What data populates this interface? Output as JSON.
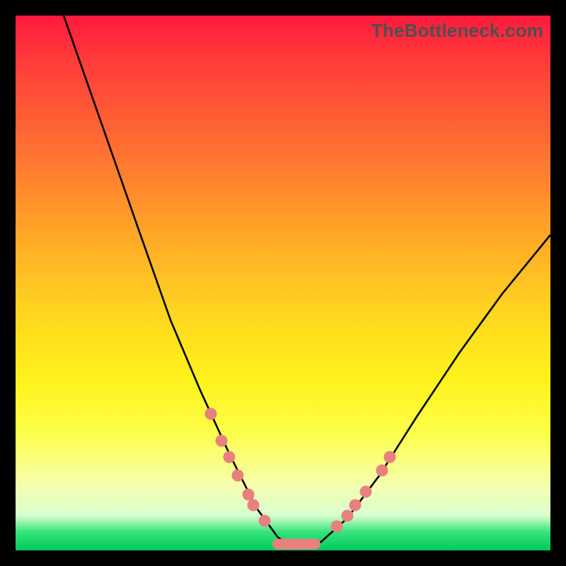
{
  "watermark": "TheBottleneck.com",
  "chart_data": {
    "type": "line",
    "title": "",
    "xlabel": "",
    "ylabel": "",
    "xlim": [
      0,
      100
    ],
    "ylim": [
      0,
      100
    ],
    "grid": false,
    "legend": false,
    "notes": "V-shaped bottleneck curve on rainbow gradient. Left branch steeper than right. Scattered coral markers near the trough along both branches.",
    "curve_left": [
      {
        "x": 9,
        "y": 100
      },
      {
        "x": 16,
        "y": 80
      },
      {
        "x": 23,
        "y": 60
      },
      {
        "x": 29,
        "y": 43
      },
      {
        "x": 34.5,
        "y": 30
      },
      {
        "x": 40,
        "y": 18
      },
      {
        "x": 45,
        "y": 8
      },
      {
        "x": 49,
        "y": 2.5
      },
      {
        "x": 52,
        "y": 0.5
      }
    ],
    "curve_right": [
      {
        "x": 52,
        "y": 0.5
      },
      {
        "x": 57,
        "y": 1.5
      },
      {
        "x": 62,
        "y": 6
      },
      {
        "x": 68,
        "y": 14
      },
      {
        "x": 75,
        "y": 25
      },
      {
        "x": 83,
        "y": 37
      },
      {
        "x": 91,
        "y": 48
      },
      {
        "x": 100,
        "y": 59
      }
    ],
    "markers_left": [
      {
        "x": 36.5,
        "y": 25.5
      },
      {
        "x": 38.5,
        "y": 20.5
      },
      {
        "x": 40,
        "y": 17.5
      },
      {
        "x": 41.6,
        "y": 14
      },
      {
        "x": 43.5,
        "y": 10.5
      },
      {
        "x": 44.5,
        "y": 8.5
      },
      {
        "x": 46.5,
        "y": 5.5
      }
    ],
    "markers_right": [
      {
        "x": 60,
        "y": 4.5
      },
      {
        "x": 62,
        "y": 6.5
      },
      {
        "x": 63.5,
        "y": 8.5
      },
      {
        "x": 65.5,
        "y": 11
      },
      {
        "x": 68.5,
        "y": 15
      },
      {
        "x": 70,
        "y": 17.5
      }
    ],
    "trough_segment": {
      "x_start": 48,
      "x_end": 57,
      "y": 1.2
    },
    "marker_color": "#e98080",
    "curve_color": "#000000"
  }
}
